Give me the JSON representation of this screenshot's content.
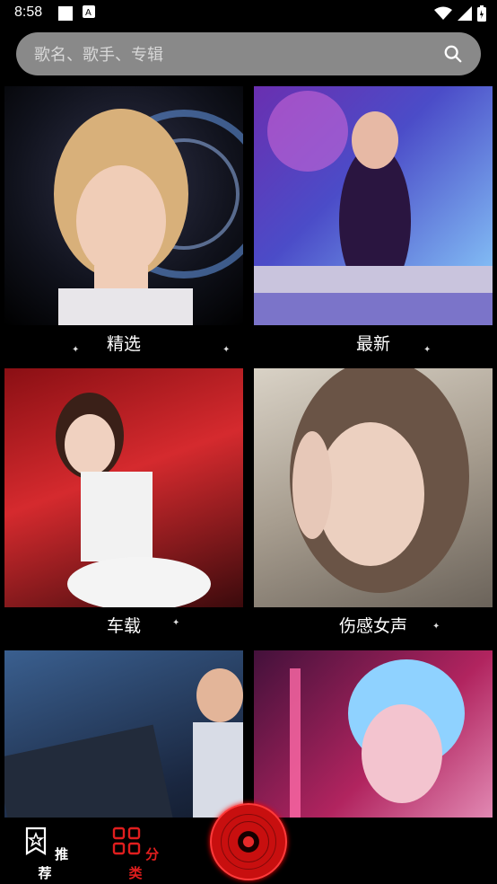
{
  "status_bar": {
    "time": "8:58"
  },
  "search": {
    "placeholder": "歌名、歌手、专辑"
  },
  "categories": [
    {
      "label": "精选",
      "icon": "photo-blonde-woman"
    },
    {
      "label": "最新",
      "icon": "photo-dj-woman"
    },
    {
      "label": "车载",
      "icon": "photo-car-woman"
    },
    {
      "label": "伤感女声",
      "icon": "photo-crying-woman"
    },
    {
      "label": "",
      "icon": "photo-dj-mixer"
    },
    {
      "label": "",
      "icon": "photo-neon-woman"
    }
  ],
  "bottom_nav": {
    "recommend_label": "推荐",
    "category_label": "分类"
  },
  "colors": {
    "accent": "#e01e1e",
    "search_bg": "#898989"
  }
}
